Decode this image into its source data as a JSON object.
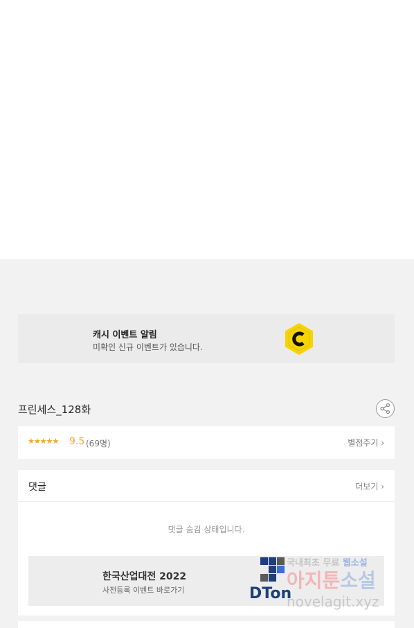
{
  "cash_banner": {
    "title": "캐시 이벤트 알림",
    "subtitle": "미확인 신규 이벤트가 있습니다.",
    "icon": "cash-coin-icon",
    "accent": "#f5d400"
  },
  "episode": {
    "title": "프린세스_128화",
    "share_icon": "share-icon"
  },
  "rating": {
    "stars": "★★★★★",
    "score": "9.5",
    "count": "(69명)",
    "rate_link": "별점주기 ›",
    "star_color": "#f5a623"
  },
  "comments": {
    "heading": "댓글",
    "more_link": "더보기 ›",
    "hidden_note": "댓글 숨김 상태입니다."
  },
  "ad": {
    "title": "한국산업대전 2022",
    "subtitle": "사전등록 이벤트 바로가기",
    "logo_text": "DTon"
  },
  "watermark": {
    "line1_a": "국내최초 무료 ",
    "line1_b": "웹소설",
    "line2_a": "아지툰",
    "line2_b": "소설",
    "url": "novelagit.xyz"
  }
}
